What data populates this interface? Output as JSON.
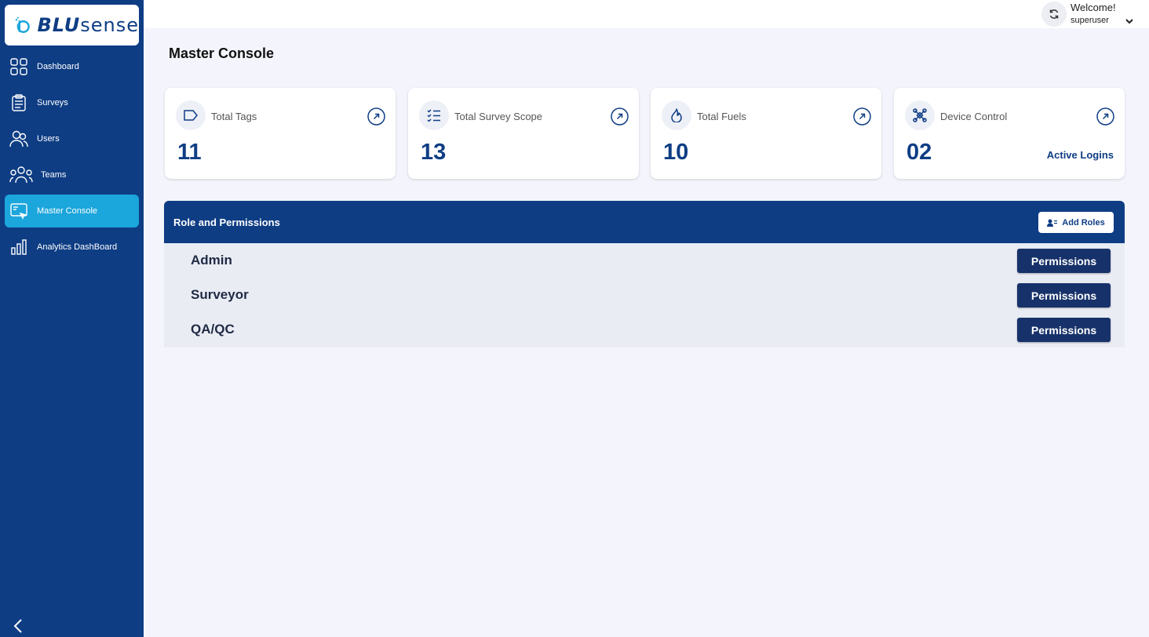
{
  "brand": {
    "logo_part1": "BLU",
    "logo_part2": "sense"
  },
  "sidebar": {
    "items": [
      {
        "label": "Dashboard",
        "icon": "grid-icon"
      },
      {
        "label": "Surveys",
        "icon": "clipboard-icon"
      },
      {
        "label": "Users",
        "icon": "users-icon"
      },
      {
        "label": "Teams",
        "icon": "teams-icon"
      },
      {
        "label": "Master Console",
        "icon": "console-icon",
        "active": true
      },
      {
        "label": "Analytics DashBoard",
        "icon": "bar-chart-icon"
      }
    ]
  },
  "header": {
    "welcome": "Welcome!",
    "username": "superuser"
  },
  "page": {
    "title": "Master Console"
  },
  "cards": [
    {
      "title": "Total Tags",
      "value": "11",
      "icon": "tag-icon"
    },
    {
      "title": "Total Survey Scope",
      "value": "13",
      "icon": "checklist-icon"
    },
    {
      "title": "Total Fuels",
      "value": "10",
      "icon": "flame-icon"
    },
    {
      "title": "Device Control",
      "value": "02",
      "icon": "device-control-icon",
      "link": "Active Logins"
    }
  ],
  "roles": {
    "title": "Role and Permissions",
    "add_label": "Add Roles",
    "items": [
      {
        "name": "Admin",
        "button": "Permissions"
      },
      {
        "name": "Surveyor",
        "button": "Permissions"
      },
      {
        "name": "QA/QC",
        "button": "Permissions"
      }
    ]
  },
  "colors": {
    "primary": "#0e3d84",
    "accent": "#1ba6dc",
    "background": "#f4f5fc"
  }
}
